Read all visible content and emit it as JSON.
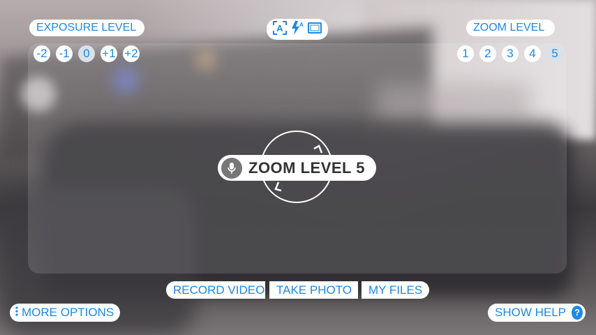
{
  "exposure": {
    "title": "EXPOSURE LEVEL",
    "levels": [
      "-2",
      "-1",
      "0",
      "+1",
      "+2"
    ],
    "selected": "0"
  },
  "zoom": {
    "title": "ZOOM LEVEL",
    "levels": [
      "1",
      "2",
      "3",
      "4",
      "5"
    ],
    "selected": "5"
  },
  "mode_icons": [
    "auto-focus-icon",
    "auto-flash-icon",
    "aspect-ratio-icon"
  ],
  "focus_toast": {
    "icon": "microphone-icon",
    "text": "ZOOM LEVEL 5"
  },
  "bottom_bar": {
    "record_video": "RECORD VIDEO",
    "take_photo": "TAKE PHOTO",
    "my_files": "MY FILES"
  },
  "more_options": {
    "icon": "vertical-dots-icon",
    "label": "MORE OPTIONS"
  },
  "show_help": {
    "label": "SHOW HELP",
    "icon_glyph": "?"
  },
  "colors": {
    "accent": "#1e88e5",
    "pill_bg": "#ffffff",
    "selected_bg": "#d9e2ea"
  }
}
